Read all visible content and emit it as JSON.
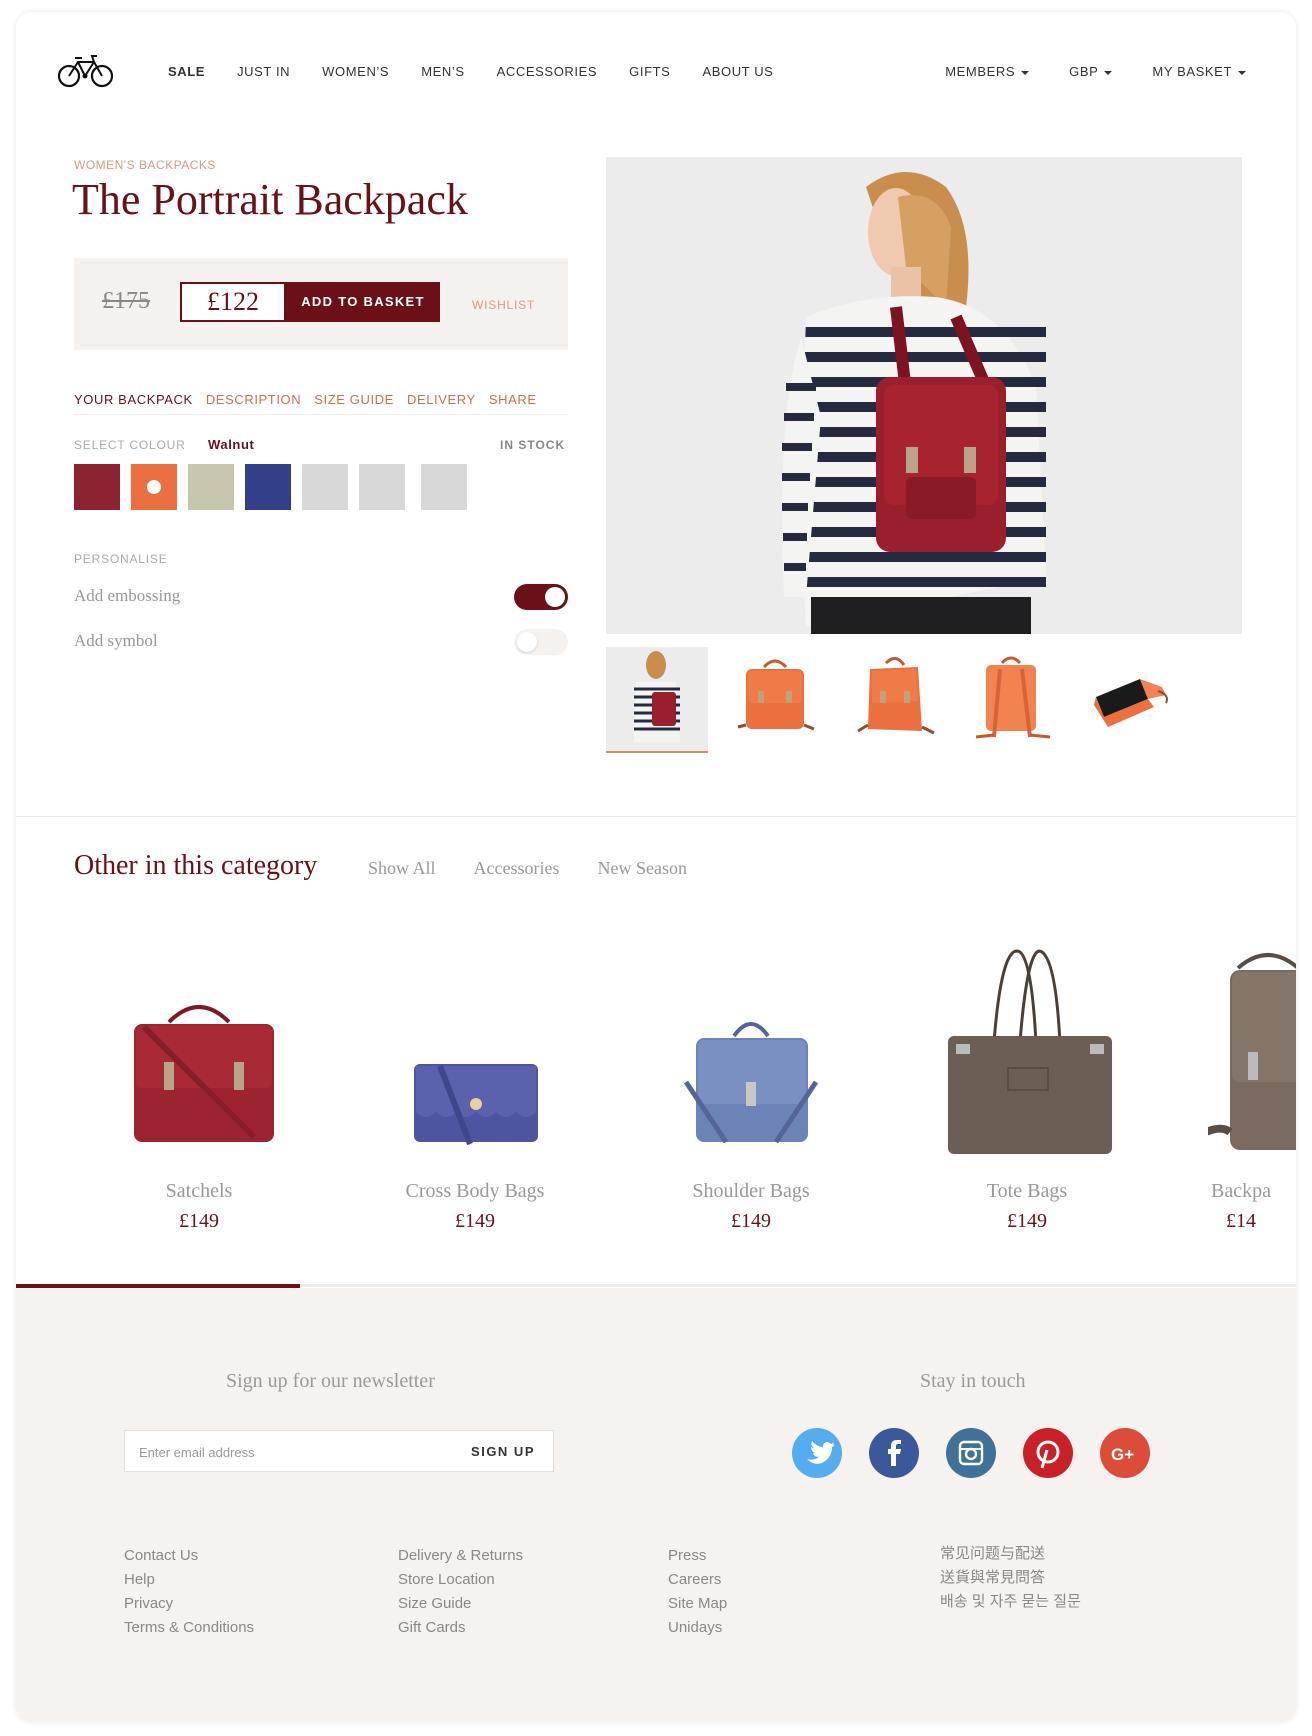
{
  "nav": {
    "items": [
      "SALE",
      "JUST IN",
      "WOMEN’S",
      "MEN’S",
      "ACCESSORIES",
      "GIFTS",
      "ABOUT US"
    ],
    "right": [
      "MEMBERS",
      "GBP",
      "MY BASKET"
    ]
  },
  "product": {
    "category": "WOMEN'S BACKPACKS",
    "title": "The Portrait Backpack",
    "old_price": "£175",
    "price": "£122",
    "add_to_basket": "ADD TO BASKET",
    "wishlist": "WISHLIST",
    "tabs": [
      "YOUR BACKPACK",
      "DESCRIPTION",
      "SIZE GUIDE",
      "DELIVERY",
      "SHARE"
    ],
    "select_colour_label": "SELECT COLOUR",
    "selected_colour": "Walnut",
    "stock": "IN STOCK",
    "colours": [
      "#8b2331",
      "#ec6f3f",
      "#c7c6ad",
      "#343f8a",
      "#d8d8d8",
      "#d8d8d8",
      "#d8d8d8"
    ],
    "personalise_label": "PERSONALISE",
    "options": [
      {
        "label": "Add embossing",
        "on": true
      },
      {
        "label": "Add symbol",
        "on": false
      }
    ]
  },
  "category_section": {
    "title": "Other in this category",
    "filters": [
      "Show All",
      "Accessories",
      "New Season"
    ],
    "products": [
      {
        "name": "Satchels",
        "price": "£149",
        "color": "#9c2430"
      },
      {
        "name": "Cross Body Bags",
        "price": "£149",
        "color": "#4e55a0"
      },
      {
        "name": "Shoulder Bags",
        "price": "£149",
        "color": "#6d82b6"
      },
      {
        "name": "Tote Bags",
        "price": "£149",
        "color": "#6d5e55"
      },
      {
        "name": "Backpa",
        "price": "£14",
        "color": "#7a6a60"
      }
    ]
  },
  "footer": {
    "newsletter_title": "Sign up for our newsletter",
    "email_placeholder": "Enter email address",
    "signup": "SIGN UP",
    "stay_title": "Stay in touch",
    "social": [
      {
        "icon": "twitter-icon",
        "color": "#55acee"
      },
      {
        "icon": "facebook-icon",
        "color": "#3b5998"
      },
      {
        "icon": "instagram-icon",
        "color": "#3f729b"
      },
      {
        "icon": "pinterest-icon",
        "color": "#cb2027"
      },
      {
        "icon": "google-plus-icon",
        "color": "#dd4b39"
      }
    ],
    "columns": [
      [
        "Contact Us",
        "Help",
        "Privacy",
        "Terms & Conditions"
      ],
      [
        "Delivery & Returns",
        "Store Location",
        "Size Guide",
        "Gift Cards"
      ],
      [
        "Press",
        "Careers",
        "Site Map",
        "Unidays"
      ],
      [
        "常见问题与配送",
        "送貨與常見問答",
        "배송 및 자주 묻는 질문"
      ]
    ]
  }
}
